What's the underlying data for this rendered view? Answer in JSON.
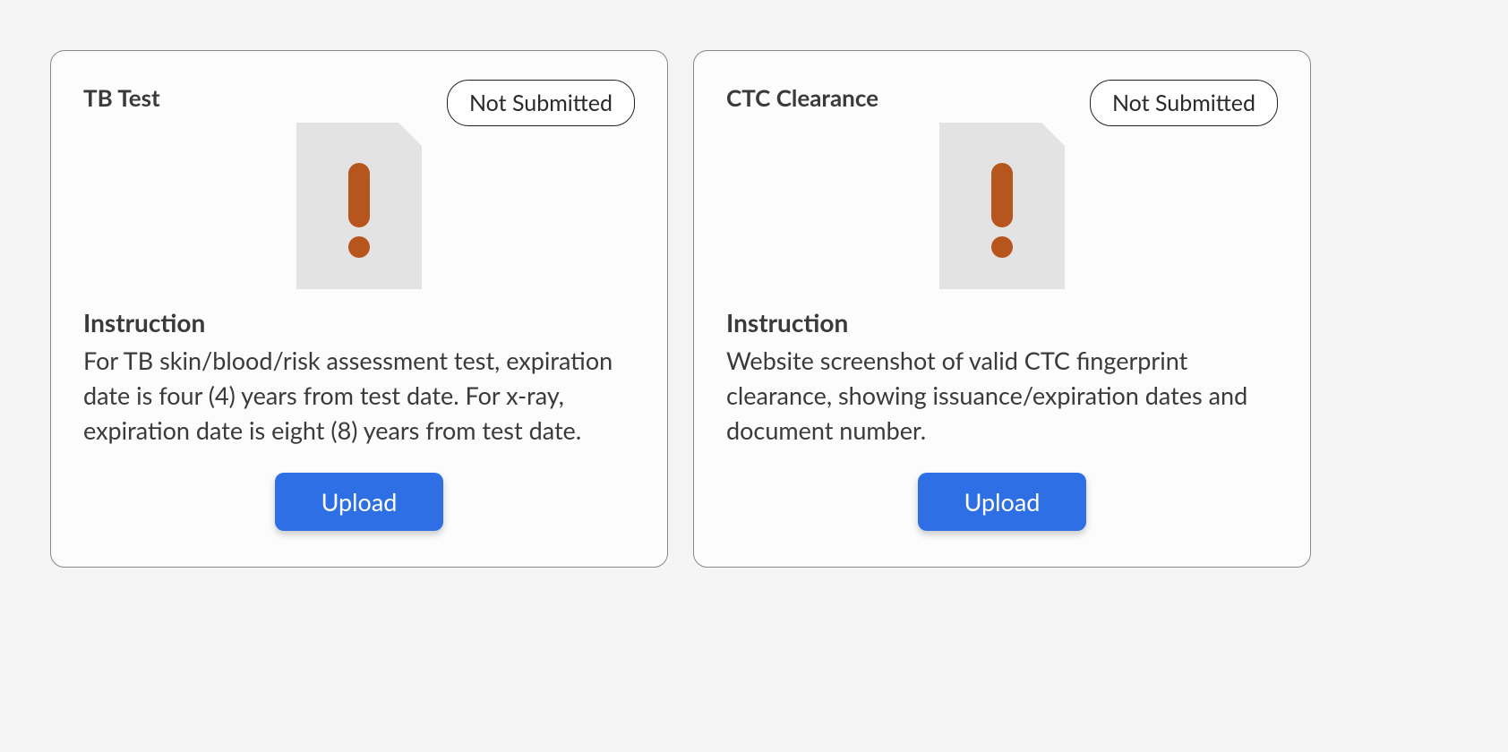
{
  "cards": [
    {
      "title": "TB Test",
      "status": "Not Submitted",
      "instruction_label": "Instruction",
      "instruction_text": "For TB skin/blood/risk assessment test, expiration date is four (4) years from test date. For x-ray, expiration date is eight (8) years from test date.",
      "upload_label": "Upload"
    },
    {
      "title": "CTC Clearance",
      "status": "Not Submitted",
      "instruction_label": "Instruction",
      "instruction_text": "Website screenshot of valid CTC fingerprint clearance, showing issuance/expiration dates and document number.",
      "upload_label": "Upload"
    }
  ]
}
